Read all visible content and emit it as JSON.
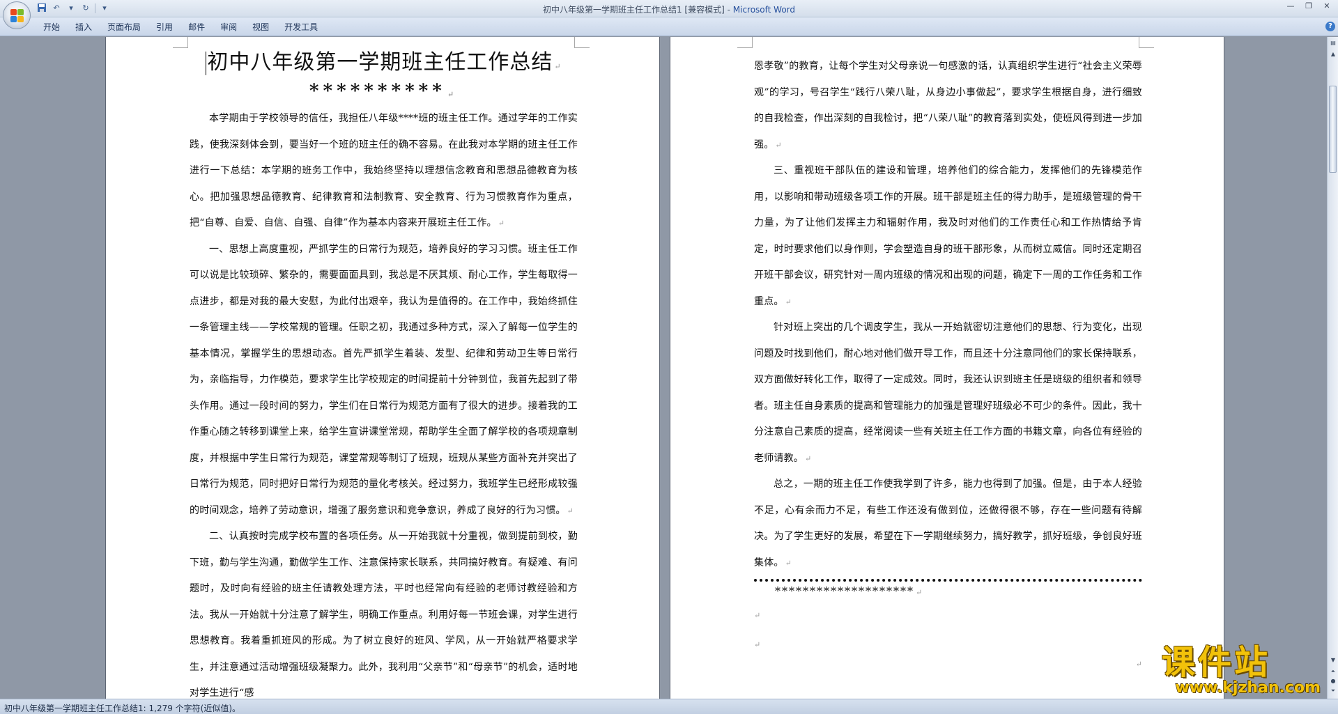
{
  "window": {
    "title_doc": "初中八年级第一学期班主任工作总结1 [兼容模式] - ",
    "title_app": "Microsoft Word"
  },
  "ribbon": {
    "tabs": [
      "开始",
      "插入",
      "页面布局",
      "引用",
      "邮件",
      "审阅",
      "视图",
      "开发工具"
    ]
  },
  "document": {
    "title": "初中八年级第一学期班主任工作总结",
    "stars": "**********",
    "page1_paragraphs": [
      "本学期由于学校领导的信任，我担任八年级****班的班主任工作。通过学年的工作实践，使我深刻体会到，要当好一个班的班主任的确不容易。在此我对本学期的班主任工作进行一下总结：本学期的班务工作中，我始终坚持以理想信念教育和思想品德教育为核心。把加强思想品德教育、纪律教育和法制教育、安全教育、行为习惯教育作为重点，把“自尊、自爱、自信、自强、自律”作为基本内容来开展班主任工作。",
      "一、思想上高度重视，严抓学生的日常行为规范，培养良好的学习习惯。班主任工作可以说是比较琐碎、繁杂的，需要面面具到，我总是不厌其烦、耐心工作，学生每取得一点进步，都是对我的最大安慰，为此付出艰辛，我认为是值得的。在工作中，我始终抓住一条管理主线——学校常规的管理。任职之初，我通过多种方式，深入了解每一位学生的基本情况，掌握学生的思想动态。首先严抓学生着装、发型、纪律和劳动卫生等日常行为，亲临指导，力作模范，要求学生比学校规定的时间提前十分钟到位，我首先起到了带头作用。通过一段时间的努力，学生们在日常行为规范方面有了很大的进步。接着我的工作重心随之转移到课堂上来，给学生宣讲课堂常规，帮助学生全面了解学校的各项规章制度，并根据中学生日常行为规范，课堂常规等制订了班规，班规从某些方面补充并突出了日常行为规范，同时把好日常行为规范的量化考核关。经过努力，我班学生已经形成较强的时间观念，培养了劳动意识，增强了服务意识和竞争意识，养成了良好的行为习惯。",
      "二、认真按时完成学校布置的各项任务。从一开始我就十分重视，做到提前到校，勤下班，勤与学生沟通，勤做学生工作、注意保持家长联系，共同搞好教育。有疑难、有问题时，及时向有经验的班主任请教处理方法，平时也经常向有经验的老师讨教经验和方法。我从一开始就十分注意了解学生，明确工作重点。利用好每一节班会课，对学生进行思想教育。我着重抓班风的形成。为了树立良好的班风、学风，从一开始就严格要求学生，并注意通过活动增强班级凝聚力。此外，我利用“父亲节”和“母亲节”的机会，适时地对学生进行“感"
    ],
    "page2_paragraphs": [
      "恩孝敬”的教育，让每个学生对父母亲说一句感激的话，认真组织学生进行“社会主义荣辱观”的学习，号召学生“践行八荣八耻，从身边小事做起”，要求学生根据自身，进行细致的自我检查，作出深刻的自我检讨，把“八荣八耻”的教育落到实处，使班风得到进一步加强。",
      "三、重视班干部队伍的建设和管理，培养他们的综合能力，发挥他们的先锋模范作用，以影响和带动班级各项工作的开展。班干部是班主任的得力助手，是班级管理的骨干力量，为了让他们发挥主力和辐射作用，我及时对他们的工作责任心和工作热情给予肯定，时时要求他们以身作则，学会塑造自身的班干部形象，从而树立威信。同时还定期召开班干部会议，研究针对一周内班级的情况和出现的问题，确定下一周的工作任务和工作重点。",
      "针对班上突出的几个调皮学生，我从一开始就密切注意他们的思想、行为变化，出现问题及时找到他们，耐心地对他们做开导工作，而且还十分注意同他们的家长保持联系，双方面做好转化工作，取得了一定成效。同时，我还认识到班主任是班级的组织者和领导者。班主任自身素质的提高和管理能力的加强是管理好班级必不可少的条件。因此，我十分注意自己素质的提高，经常阅读一些有关班主任工作方面的书籍文章，向各位有经验的老师请教。",
      "总之，一期的班主任工作使我学到了许多，能力也得到了加强。但是，由于本人经验不足，心有余而力不足，有些工作还没有做到位，还做得很不够，存在一些问题有待解决。为了学生更好的发展，希望在下一学期继续努力，搞好教学，抓好班级，争创良好班集体。"
    ],
    "page2_trailing_stars": "********************",
    "paragraph_mark": "↵"
  },
  "statusbar": {
    "text": "初中八年级第一学期班主任工作总结1: 1,279 个字符(近似值)。"
  },
  "watermark": {
    "title": "课件站",
    "url": "www.kjzhan.com"
  }
}
